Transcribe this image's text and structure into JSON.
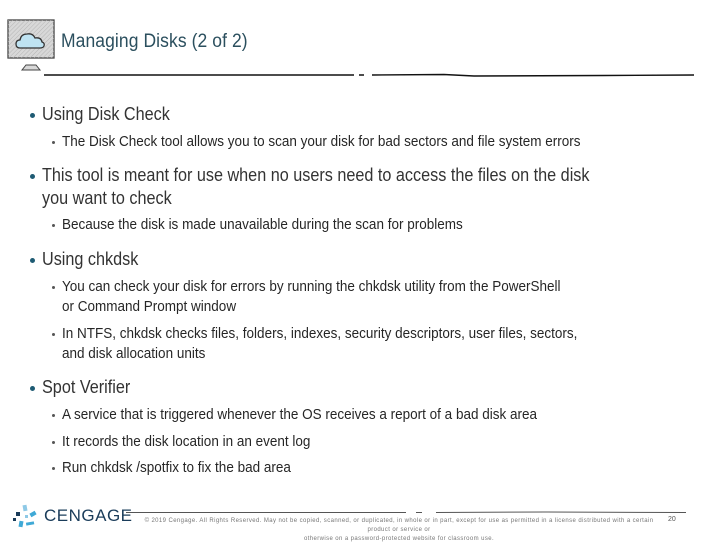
{
  "header": {
    "title": "Managing Disks (2 of 2)",
    "icon": "monitor-cloud-icon"
  },
  "bullets": [
    {
      "text": "Using Disk Check",
      "children": [
        {
          "lines": [
            "The Disk Check tool allows you to scan your disk for bad sectors and file system errors"
          ]
        }
      ]
    },
    {
      "lines": [
        "This tool is meant for use when no users need to access the files on the disk",
        "you want to check"
      ],
      "children": [
        {
          "lines": [
            "Because the disk is made unavailable during the scan for problems"
          ]
        }
      ]
    },
    {
      "text": "Using chkdsk",
      "children": [
        {
          "lines": [
            "You can check your disk for errors by running the chkdsk utility from the PowerShell",
            "or Command Prompt window"
          ]
        },
        {
          "lines": [
            "In NTFS, chkdsk checks files, folders, indexes, security descriptors, user files, sectors,",
            "and disk allocation units"
          ]
        }
      ]
    },
    {
      "text": "Spot Verifier",
      "children": [
        {
          "lines": [
            "A service that is triggered whenever the OS receives a report of a bad disk area"
          ]
        },
        {
          "lines": [
            "It records the disk location in an event log"
          ]
        },
        {
          "lines": [
            "Run chkdsk /spotfix to fix the bad area"
          ]
        }
      ]
    }
  ],
  "footer": {
    "logo_text": "CENGAGE",
    "copyright_line1": "© 2019 Cengage. All Rights Reserved. May not be copied, scanned, or duplicated, in whole or in part, except for use as permitted in a license distributed with a certain product or service or",
    "copyright_line2": "otherwise on a password-protected website for classroom use.",
    "page_number": "20"
  },
  "colors": {
    "title": "#2b4f5e",
    "bullet": "#1e5b73",
    "logo_text": "#1a3c5a",
    "logo_accent": "#3fa9d6"
  }
}
